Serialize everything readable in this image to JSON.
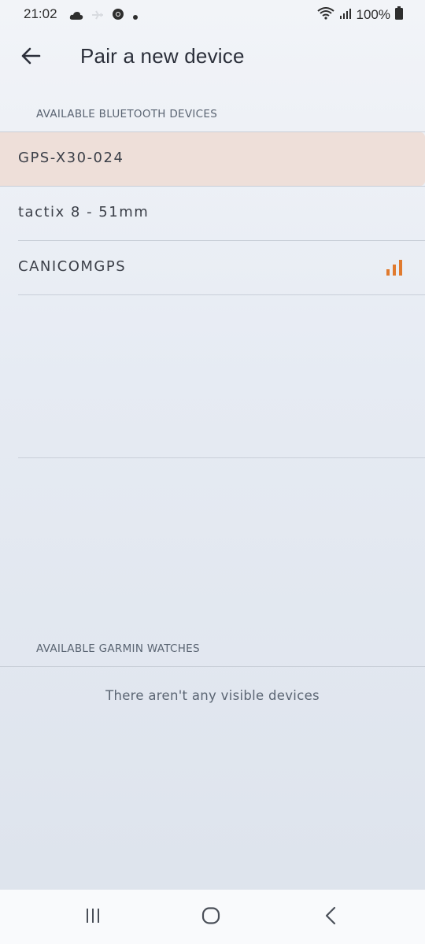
{
  "status_bar": {
    "time": "21:02",
    "battery": "100%",
    "icons": [
      "cloud-icon",
      "airplane-icon",
      "chrome-icon",
      "dot-icon",
      "wifi-icon",
      "cell-signal-icon",
      "battery-icon"
    ]
  },
  "app_bar": {
    "title": "Pair a new device",
    "back_icon": "arrow-left-icon"
  },
  "bluetooth_section": {
    "header": "AVAILABLE BLUETOOTH DEVICES",
    "devices": [
      {
        "name": "GPS-X30-024",
        "selected": true
      },
      {
        "name": "tactix 8 - 51mm",
        "selected": false
      },
      {
        "name": "CANICOMGPS",
        "selected": false,
        "signal_icon": "signal-bars-icon"
      }
    ]
  },
  "garmin_section": {
    "header": "AVAILABLE GARMIN WATCHES",
    "empty_message": "There aren't any visible devices"
  },
  "nav_bar": {
    "recents_icon": "recents-icon",
    "home_icon": "home-icon",
    "back_icon": "back-chevron-icon"
  },
  "colors": {
    "accent": "#e07a2e",
    "selected_row": "#eedfd9",
    "divider": "#c9cfd8"
  }
}
